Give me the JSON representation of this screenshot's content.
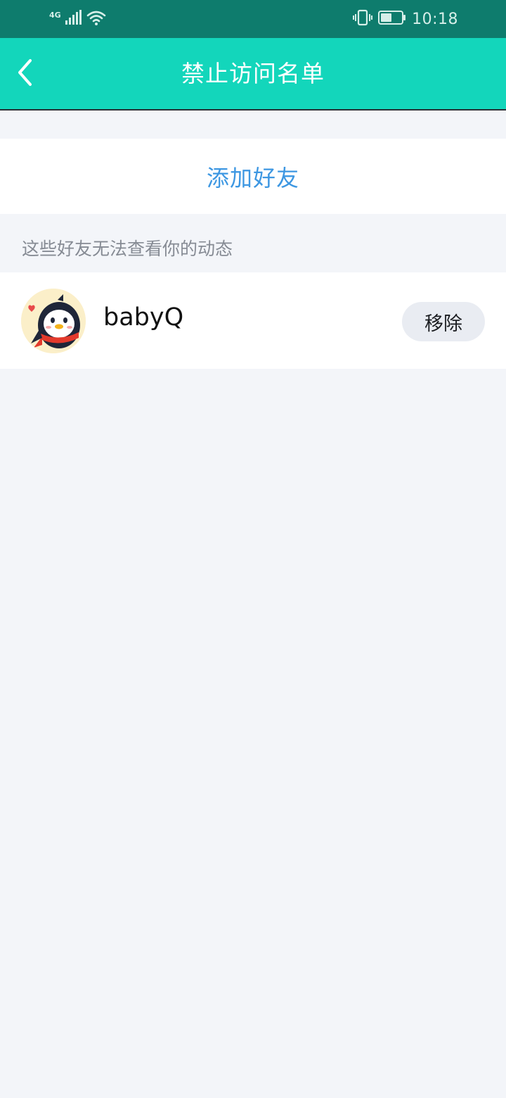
{
  "status_bar": {
    "network": "4G",
    "time": "10:18",
    "icons": [
      "signal-icon",
      "wifi-icon",
      "vibrate-icon",
      "battery-icon"
    ]
  },
  "header": {
    "back_icon": "chevron-left-icon",
    "title": "禁止访问名单"
  },
  "add_friend": {
    "label": "添加好友"
  },
  "section": {
    "note": "这些好友无法查看你的动态"
  },
  "friends": [
    {
      "name": "babyQ",
      "avatar_icon": "penguin-avatar-icon",
      "action_label": "移除"
    }
  ],
  "colors": {
    "status_bar": "#0e7c6d",
    "header": "#13d6bb",
    "link_blue": "#3d97e2",
    "page_bg": "#f3f5f9",
    "button_bg": "#e9ecf2"
  }
}
